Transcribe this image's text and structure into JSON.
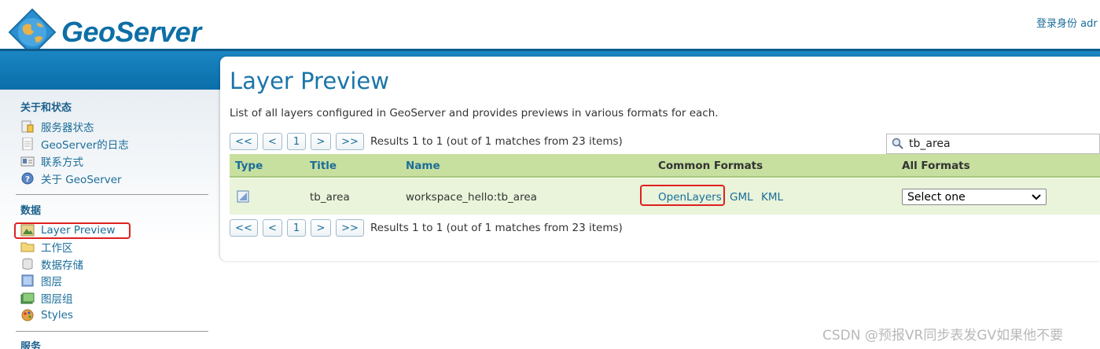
{
  "header": {
    "logo_text": "GeoServer",
    "login_text": "登录身份 adr"
  },
  "sidebar": {
    "sections": [
      {
        "title": "关于和状态",
        "items": [
          {
            "label": "服务器状态",
            "icon": "server-status-icon"
          },
          {
            "label": "GeoServer的日志",
            "icon": "log-icon"
          },
          {
            "label": "联系方式",
            "icon": "contact-icon"
          },
          {
            "label": "关于 GeoServer",
            "icon": "about-icon"
          }
        ]
      },
      {
        "title": "数据",
        "items": [
          {
            "label": "Layer Preview",
            "icon": "layer-preview-icon"
          },
          {
            "label": "工作区",
            "icon": "folder-icon"
          },
          {
            "label": "数据存储",
            "icon": "database-icon"
          },
          {
            "label": "图层",
            "icon": "layer-icon"
          },
          {
            "label": "图层组",
            "icon": "layer-group-icon"
          },
          {
            "label": "Styles",
            "icon": "styles-icon"
          }
        ]
      },
      {
        "title": "服务",
        "items": []
      }
    ]
  },
  "main": {
    "title": "Layer Preview",
    "description": "List of all layers configured in GeoServer and provides previews in various formats for each.",
    "pager": {
      "first": "<<",
      "prev": "<",
      "page": "1",
      "next": ">",
      "last": ">>",
      "results": "Results 1 to 1 (out of 1 matches from 23 items)"
    },
    "search": {
      "value": "tb_area"
    },
    "table": {
      "headers": [
        "Type",
        "Title",
        "Name",
        "Common Formats",
        "All Formats"
      ],
      "rows": [
        {
          "type_icon": "vector-layer-icon",
          "title": "tb_area",
          "name": "workspace_hello:tb_area",
          "formats": [
            "OpenLayers",
            "GML",
            "KML"
          ],
          "all_formats": "Select one"
        }
      ]
    }
  },
  "watermark": "CSDN @预报VR同步表发GV如果他不要",
  "colors": {
    "accent": "#1b6d9a",
    "band": "#0a6eaa",
    "table_header": "#c7df9f",
    "table_row": "#e9f4da",
    "highlight": "#e02020"
  }
}
